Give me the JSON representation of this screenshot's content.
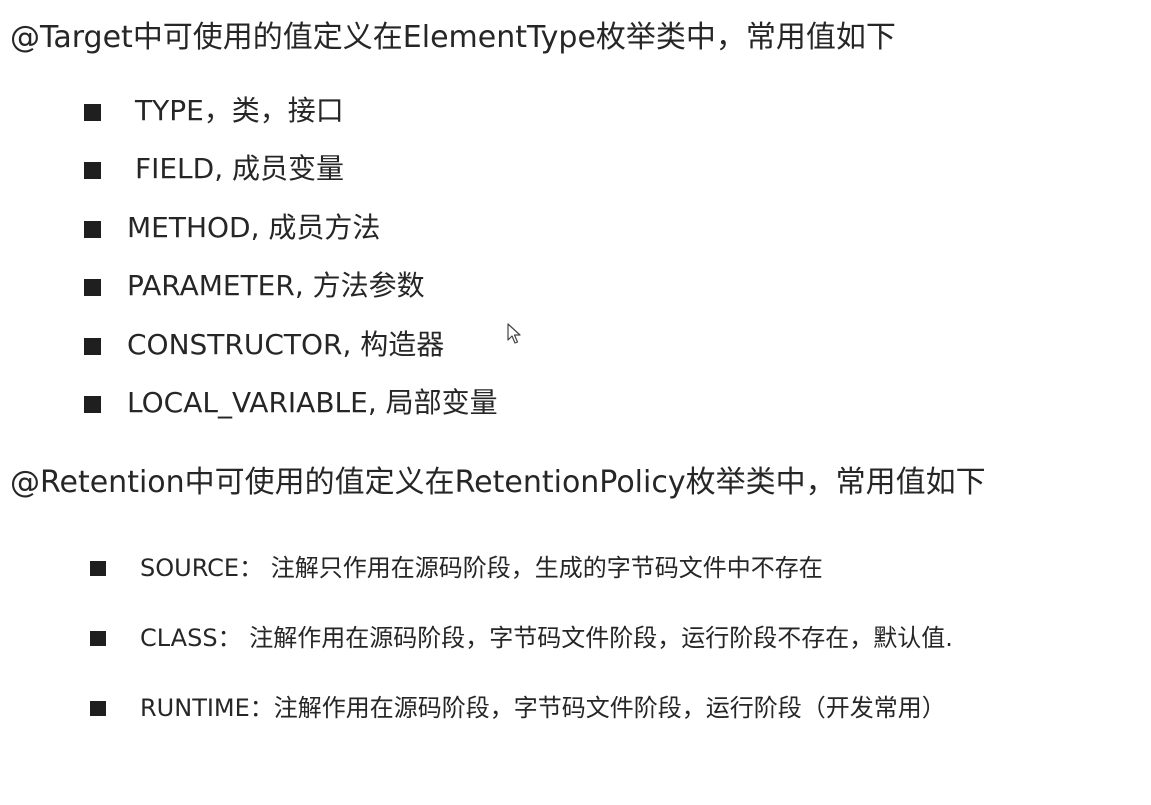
{
  "target_section": {
    "heading": "@Target中可使用的值定义在ElementType枚举类中，常用值如下",
    "items": [
      {
        "label": "TYPE，类，接口"
      },
      {
        "label": "FIELD, 成员变量"
      },
      {
        "label": "METHOD, 成员方法"
      },
      {
        "label": "PARAMETER, 方法参数"
      },
      {
        "label": "CONSTRUCTOR, 构造器"
      },
      {
        "label": "LOCAL_VARIABLE, 局部变量"
      }
    ]
  },
  "retention_section": {
    "heading": "@Retention中可使用的值定义在RetentionPolicy枚举类中，常用值如下",
    "items": [
      {
        "label": "SOURCE：  注解只作用在源码阶段，生成的字节码文件中不存在"
      },
      {
        "label": "CLASS：   注解作用在源码阶段，字节码文件阶段，运行阶段不存在，默认值."
      },
      {
        "label": "RUNTIME：注解作用在源码阶段，字节码文件阶段，运行阶段（开发常用）"
      }
    ]
  },
  "icons": {
    "bullet": "square-bullet-icon",
    "cursor": "mouse-pointer-icon"
  }
}
